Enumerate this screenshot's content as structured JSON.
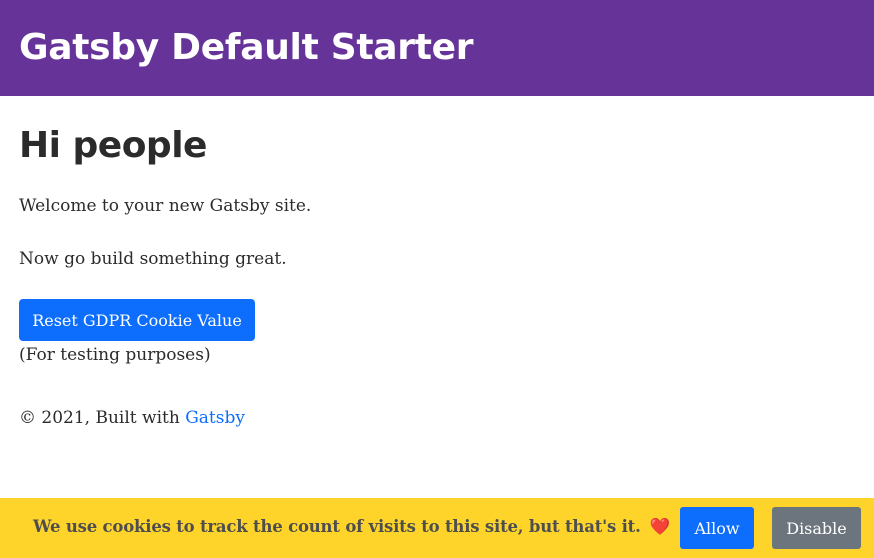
{
  "header": {
    "site_title": "Gatsby Default Starter",
    "background_color": "#663399"
  },
  "main": {
    "heading": "Hi people",
    "paragraph_1": "Welcome to your new Gatsby site.",
    "paragraph_2": "Now go build something great.",
    "reset_button_label": "Reset GDPR Cookie Value",
    "testing_note": "(For testing purposes)"
  },
  "footer": {
    "copyright": "© 2021, Built with",
    "link_label": "Gatsby"
  },
  "cookie_banner": {
    "message": "We use cookies to track the count of visits to this site, but that's it.",
    "heart": "❤️",
    "allow_label": "Allow",
    "disable_label": "Disable",
    "background_color": "#ffd42a"
  },
  "colors": {
    "primary_button": "#0d6efd",
    "secondary_button": "#6c757d",
    "link": "#0d6efd"
  }
}
